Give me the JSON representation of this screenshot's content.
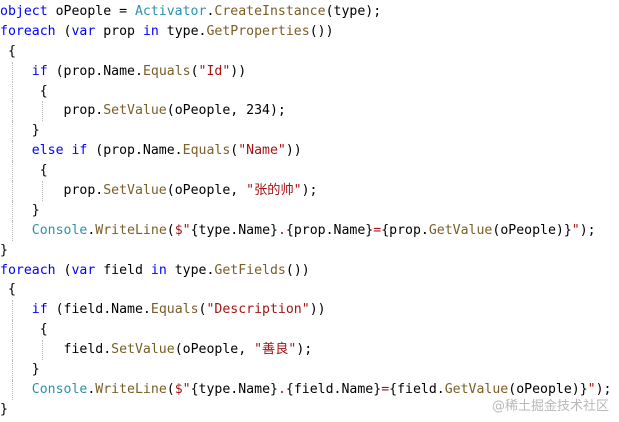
{
  "colors": {
    "keyword": "#0000ff",
    "identifier": "#000000",
    "method": "#795e26",
    "class": "#2b91af",
    "string": "#a31515",
    "background": "#ffffff",
    "indent_guide": "#b9b9b9",
    "watermark": "#b8b8b8"
  },
  "code": {
    "lines": [
      {
        "indent": 0,
        "tokens": [
          {
            "t": "object ",
            "k": "kw"
          },
          {
            "t": "oPeople = ",
            "k": "id"
          },
          {
            "t": "Activator",
            "k": "class"
          },
          {
            "t": ".",
            "k": "punct"
          },
          {
            "t": "CreateInstance",
            "k": "call"
          },
          {
            "t": "(type);",
            "k": "id"
          }
        ]
      },
      {
        "indent": 0,
        "tokens": [
          {
            "t": "foreach",
            "k": "kw"
          },
          {
            "t": " (",
            "k": "punct"
          },
          {
            "t": "var",
            "k": "kw"
          },
          {
            "t": " prop ",
            "k": "id"
          },
          {
            "t": "in",
            "k": "kw"
          },
          {
            "t": " type.",
            "k": "id"
          },
          {
            "t": "GetProperties",
            "k": "call"
          },
          {
            "t": "())",
            "k": "punct"
          }
        ]
      },
      {
        "indent": 0,
        "tokens": [
          {
            "t": " {",
            "k": "punct"
          }
        ]
      },
      {
        "indent": 1,
        "tokens": [
          {
            "t": "    ",
            "k": "id"
          },
          {
            "t": "if",
            "k": "kw"
          },
          {
            "t": " (prop.Name.",
            "k": "id"
          },
          {
            "t": "Equals",
            "k": "call"
          },
          {
            "t": "(",
            "k": "punct"
          },
          {
            "t": "\"Id\"",
            "k": "str"
          },
          {
            "t": "))",
            "k": "punct"
          }
        ]
      },
      {
        "indent": 1,
        "tokens": [
          {
            "t": "     {",
            "k": "punct"
          }
        ]
      },
      {
        "indent": 2,
        "tokens": [
          {
            "t": "        prop.",
            "k": "id"
          },
          {
            "t": "SetValue",
            "k": "call"
          },
          {
            "t": "(oPeople, 234);",
            "k": "id"
          }
        ]
      },
      {
        "indent": 1,
        "tokens": [
          {
            "t": "    }",
            "k": "punct"
          }
        ]
      },
      {
        "indent": 1,
        "tokens": [
          {
            "t": "    ",
            "k": "id"
          },
          {
            "t": "else if",
            "k": "kw"
          },
          {
            "t": " (prop.Name.",
            "k": "id"
          },
          {
            "t": "Equals",
            "k": "call"
          },
          {
            "t": "(",
            "k": "punct"
          },
          {
            "t": "\"Name\"",
            "k": "str"
          },
          {
            "t": "))",
            "k": "punct"
          }
        ]
      },
      {
        "indent": 1,
        "tokens": [
          {
            "t": "     {",
            "k": "punct"
          }
        ]
      },
      {
        "indent": 2,
        "tokens": [
          {
            "t": "        prop.",
            "k": "id"
          },
          {
            "t": "SetValue",
            "k": "call"
          },
          {
            "t": "(oPeople, ",
            "k": "id"
          },
          {
            "t": "\"张的帅\"",
            "k": "str"
          },
          {
            "t": ");",
            "k": "punct"
          }
        ]
      },
      {
        "indent": 1,
        "tokens": [
          {
            "t": "    }",
            "k": "punct"
          }
        ]
      },
      {
        "indent": 1,
        "tokens": [
          {
            "t": "    ",
            "k": "id"
          },
          {
            "t": "Console",
            "k": "class"
          },
          {
            "t": ".",
            "k": "punct"
          },
          {
            "t": "WriteLine",
            "k": "call"
          },
          {
            "t": "(",
            "k": "punct"
          },
          {
            "t": "$\"",
            "k": "str"
          },
          {
            "t": "{type.Name}",
            "k": "id"
          },
          {
            "t": ".",
            "k": "str"
          },
          {
            "t": "{prop.Name}",
            "k": "id"
          },
          {
            "t": "=",
            "k": "str"
          },
          {
            "t": "{prop.",
            "k": "id"
          },
          {
            "t": "GetValue",
            "k": "call"
          },
          {
            "t": "(oPeople)}",
            "k": "id"
          },
          {
            "t": "\"",
            "k": "str"
          },
          {
            "t": ");",
            "k": "punct"
          }
        ]
      },
      {
        "indent": 0,
        "tokens": [
          {
            "t": "}",
            "k": "punct"
          }
        ]
      },
      {
        "indent": 0,
        "tokens": [
          {
            "t": "foreach",
            "k": "kw"
          },
          {
            "t": " (",
            "k": "punct"
          },
          {
            "t": "var",
            "k": "kw"
          },
          {
            "t": " field ",
            "k": "id"
          },
          {
            "t": "in",
            "k": "kw"
          },
          {
            "t": " type.",
            "k": "id"
          },
          {
            "t": "GetFields",
            "k": "call"
          },
          {
            "t": "())",
            "k": "punct"
          }
        ]
      },
      {
        "indent": 0,
        "tokens": [
          {
            "t": " {",
            "k": "punct"
          }
        ]
      },
      {
        "indent": 1,
        "tokens": [
          {
            "t": "    ",
            "k": "id"
          },
          {
            "t": "if",
            "k": "kw"
          },
          {
            "t": " (field.Name.",
            "k": "id"
          },
          {
            "t": "Equals",
            "k": "call"
          },
          {
            "t": "(",
            "k": "punct"
          },
          {
            "t": "\"Description\"",
            "k": "str"
          },
          {
            "t": "))",
            "k": "punct"
          }
        ]
      },
      {
        "indent": 1,
        "tokens": [
          {
            "t": "     {",
            "k": "punct"
          }
        ]
      },
      {
        "indent": 2,
        "tokens": [
          {
            "t": "        field.",
            "k": "id"
          },
          {
            "t": "SetValue",
            "k": "call"
          },
          {
            "t": "(oPeople, ",
            "k": "id"
          },
          {
            "t": "\"善良\"",
            "k": "str"
          },
          {
            "t": ");",
            "k": "punct"
          }
        ]
      },
      {
        "indent": 1,
        "tokens": [
          {
            "t": "    }",
            "k": "punct"
          }
        ]
      },
      {
        "indent": 1,
        "tokens": [
          {
            "t": "    ",
            "k": "id"
          },
          {
            "t": "Console",
            "k": "class"
          },
          {
            "t": ".",
            "k": "punct"
          },
          {
            "t": "WriteLine",
            "k": "call"
          },
          {
            "t": "(",
            "k": "punct"
          },
          {
            "t": "$\"",
            "k": "str"
          },
          {
            "t": "{type.Name}",
            "k": "id"
          },
          {
            "t": ".",
            "k": "str"
          },
          {
            "t": "{field.Name}",
            "k": "id"
          },
          {
            "t": "=",
            "k": "str"
          },
          {
            "t": "{field.",
            "k": "id"
          },
          {
            "t": "GetValue",
            "k": "call"
          },
          {
            "t": "(oPeople)}",
            "k": "id"
          },
          {
            "t": "\"",
            "k": "str"
          },
          {
            "t": ");",
            "k": "punct"
          }
        ]
      },
      {
        "indent": 0,
        "tokens": [
          {
            "t": "}",
            "k": "punct"
          }
        ]
      }
    ]
  },
  "watermark": {
    "text": "@稀土掘金技术社区"
  }
}
